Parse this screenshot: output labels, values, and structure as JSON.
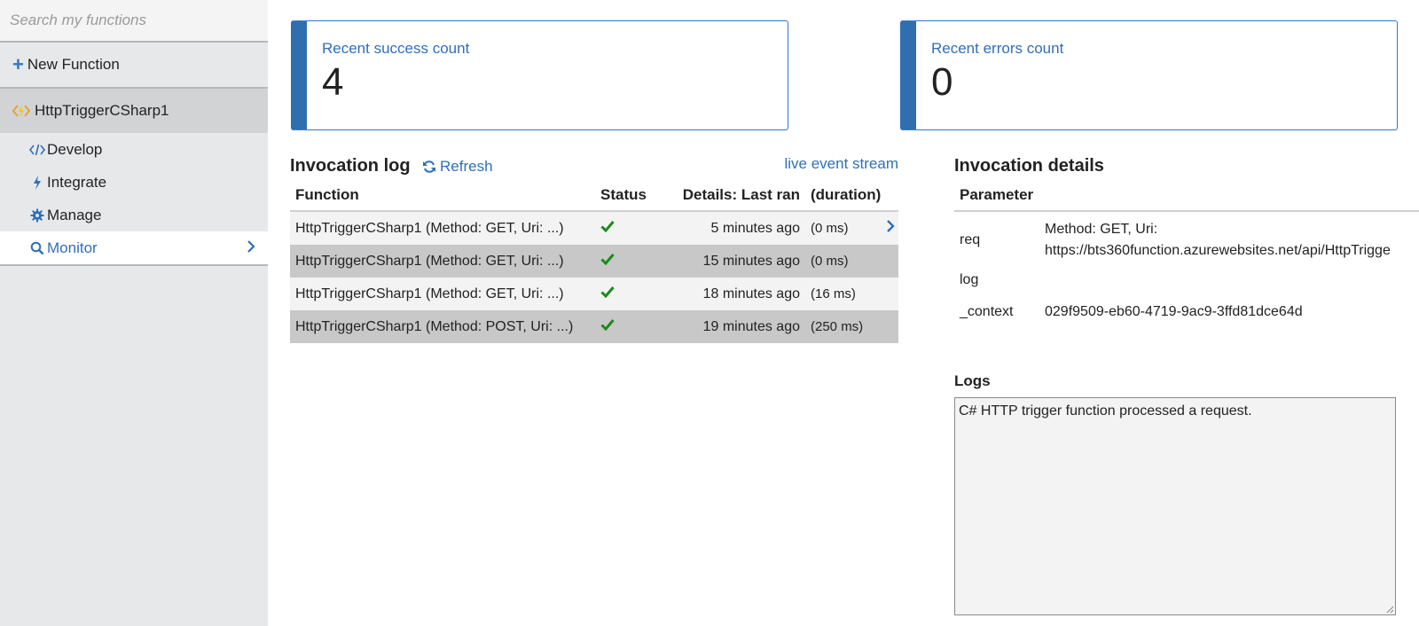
{
  "sidebar": {
    "search_placeholder": "Search my functions",
    "new_function_label": "New Function",
    "function_name": "HttpTriggerCSharp1",
    "items": [
      {
        "label": "Develop",
        "icon": "code-icon"
      },
      {
        "label": "Integrate",
        "icon": "lightning-icon"
      },
      {
        "label": "Manage",
        "icon": "gear-icon"
      },
      {
        "label": "Monitor",
        "icon": "search-icon",
        "active": true
      }
    ]
  },
  "cards": {
    "success": {
      "label": "Recent success count",
      "value": "4"
    },
    "errors": {
      "label": "Recent errors count",
      "value": "0"
    }
  },
  "invocation_log": {
    "title": "Invocation log",
    "refresh_label": "Refresh",
    "live_stream_label": "live event stream",
    "columns": {
      "function": "Function",
      "status": "Status",
      "last_ran": "Details: Last ran",
      "duration": "(duration)"
    },
    "rows": [
      {
        "function": "HttpTriggerCSharp1 (Method: GET, Uri: ...)",
        "status": "success",
        "last_ran": "5 minutes ago",
        "duration": "(0 ms)"
      },
      {
        "function": "HttpTriggerCSharp1 (Method: GET, Uri: ...)",
        "status": "success",
        "last_ran": "15 minutes ago",
        "duration": "(0 ms)"
      },
      {
        "function": "HttpTriggerCSharp1 (Method: GET, Uri: ...)",
        "status": "success",
        "last_ran": "18 minutes ago",
        "duration": "(16 ms)"
      },
      {
        "function": "HttpTriggerCSharp1 (Method: POST, Uri: ...)",
        "status": "success",
        "last_ran": "19 minutes ago",
        "duration": "(250 ms)"
      }
    ]
  },
  "invocation_details": {
    "title": "Invocation details",
    "parameter_header": "Parameter",
    "params": [
      {
        "key": "req",
        "value_line1": "Method: GET, Uri:",
        "value_line2": "https://bts360function.azurewebsites.net/api/HttpTrigge"
      },
      {
        "key": "log",
        "value": ""
      },
      {
        "key": "_context",
        "value": "029f9509-eb60-4719-9ac9-3ffd81dce64d"
      }
    ]
  },
  "logs": {
    "title": "Logs",
    "content": "C# HTTP trigger function processed a request."
  },
  "colors": {
    "accent": "#2f6fb8",
    "card_border": "#2f6fb0",
    "success_check": "#1a8a1a",
    "sidebar_bg": "#e7e8ea"
  }
}
